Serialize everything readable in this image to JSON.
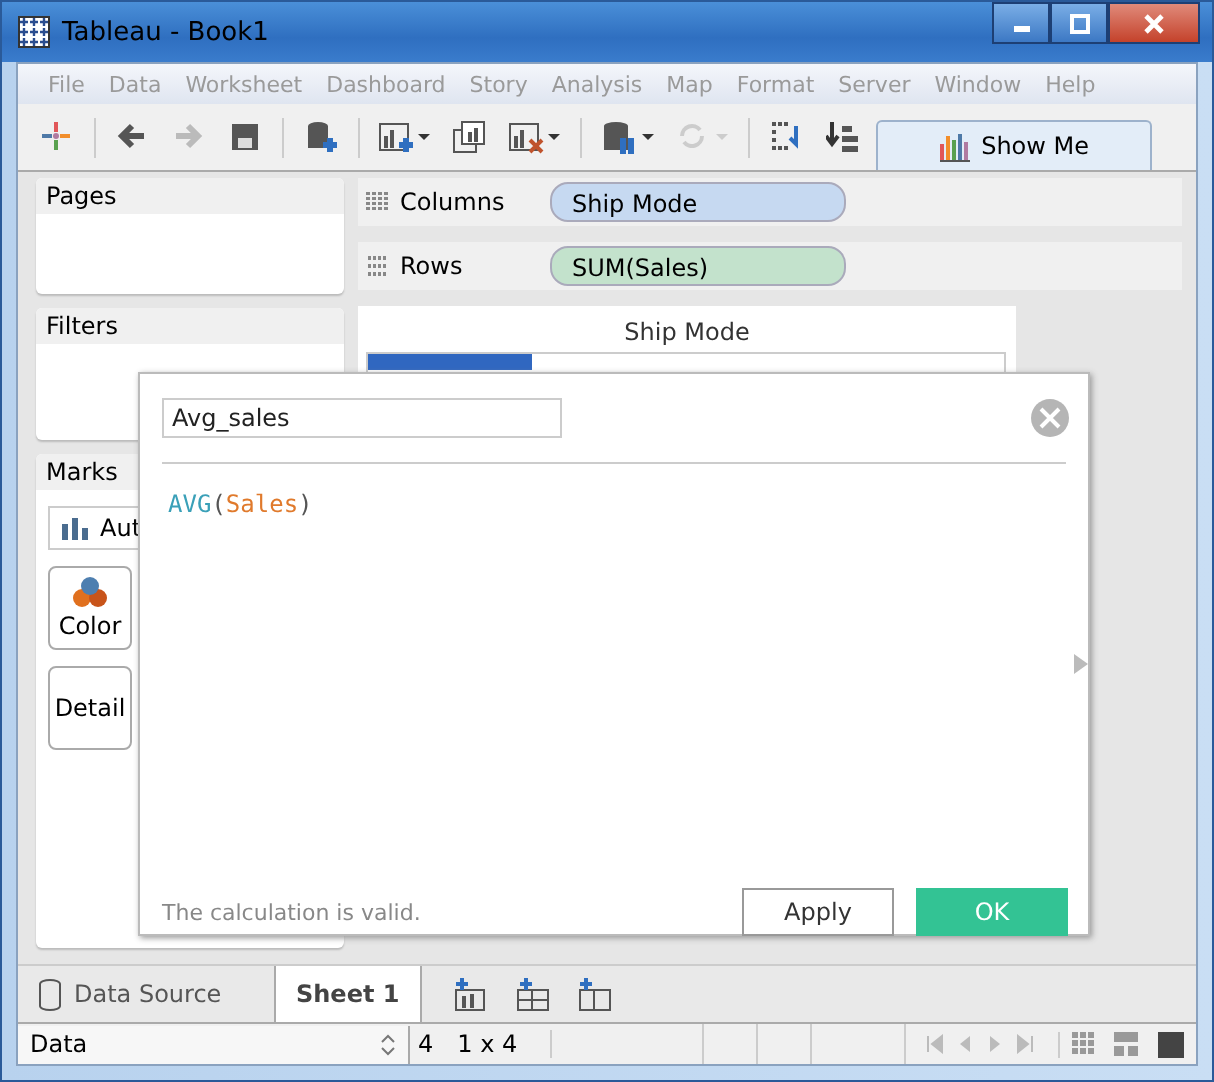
{
  "window": {
    "title": "Tableau - Book1"
  },
  "menu": {
    "disabled": true,
    "items": [
      "File",
      "Data",
      "Worksheet",
      "Dashboard",
      "Story",
      "Analysis",
      "Map",
      "Format",
      "Server",
      "Window",
      "Help"
    ]
  },
  "toolbar": {
    "show_me": "Show Me"
  },
  "left_panel": {
    "pages": {
      "title": "Pages"
    },
    "filters": {
      "title": "Filters"
    },
    "marks": {
      "title": "Marks",
      "mark_type": "Aut",
      "buttons": [
        {
          "label": "Color",
          "kind": "color"
        },
        {
          "label": "Detail",
          "kind": "detail"
        }
      ]
    }
  },
  "shelves": [
    {
      "label": "Columns",
      "kind": "columns",
      "pill": "Ship Mode",
      "color": "#c6d9f1"
    },
    {
      "label": "Rows",
      "kind": "rows",
      "pill": "SUM(Sales)",
      "color": "#c3e2cc"
    }
  ],
  "view": {
    "header": "Ship Mode"
  },
  "dialog": {
    "name": "Avg_sales",
    "formula": [
      {
        "text": "AVG",
        "kind": "function"
      },
      {
        "text": "(",
        "kind": "punct"
      },
      {
        "text": "Sales",
        "kind": "field"
      },
      {
        "text": ")",
        "kind": "punct"
      }
    ],
    "status": "The calculation is valid.",
    "apply": "Apply",
    "ok": "OK"
  },
  "sheet_tabs": [
    {
      "label": "Data Source",
      "kind": "data_source",
      "selected": false
    },
    {
      "label": "Sheet 1",
      "kind": "sheet",
      "selected": true
    }
  ],
  "status_bar": {
    "data_selector": "Data",
    "marks": "4",
    "dimensions": "1 x 4"
  }
}
